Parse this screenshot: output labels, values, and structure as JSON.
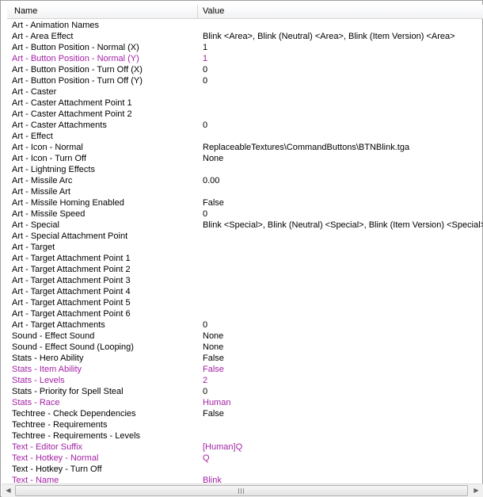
{
  "header": {
    "name": "Name",
    "value": "Value"
  },
  "rows": [
    {
      "name": "Art - Animation Names",
      "value": "",
      "mod": false
    },
    {
      "name": "Art - Area Effect",
      "value": "Blink <Area>, Blink (Neutral) <Area>, Blink (Item Version) <Area>",
      "mod": false
    },
    {
      "name": "Art - Button Position - Normal (X)",
      "value": "1",
      "mod": false
    },
    {
      "name": "Art - Button Position - Normal (Y)",
      "value": "1",
      "mod": true
    },
    {
      "name": "Art - Button Position - Turn Off (X)",
      "value": "0",
      "mod": false
    },
    {
      "name": "Art - Button Position - Turn Off (Y)",
      "value": "0",
      "mod": false
    },
    {
      "name": "Art - Caster",
      "value": "",
      "mod": false
    },
    {
      "name": "Art - Caster Attachment Point 1",
      "value": "",
      "mod": false
    },
    {
      "name": "Art - Caster Attachment Point 2",
      "value": "",
      "mod": false
    },
    {
      "name": "Art - Caster Attachments",
      "value": "0",
      "mod": false
    },
    {
      "name": "Art - Effect",
      "value": "",
      "mod": false
    },
    {
      "name": "Art - Icon - Normal",
      "value": "ReplaceableTextures\\CommandButtons\\BTNBlink.tga",
      "mod": false
    },
    {
      "name": "Art - Icon - Turn Off",
      "value": "None",
      "mod": false
    },
    {
      "name": "Art - Lightning Effects",
      "value": "",
      "mod": false
    },
    {
      "name": "Art - Missile Arc",
      "value": "0.00",
      "mod": false
    },
    {
      "name": "Art - Missile Art",
      "value": "",
      "mod": false
    },
    {
      "name": "Art - Missile Homing Enabled",
      "value": "False",
      "mod": false
    },
    {
      "name": "Art - Missile Speed",
      "value": "0",
      "mod": false
    },
    {
      "name": "Art - Special",
      "value": "Blink <Special>, Blink (Neutral) <Special>, Blink (Item Version) <Special>",
      "mod": false
    },
    {
      "name": "Art - Special Attachment Point",
      "value": "",
      "mod": false
    },
    {
      "name": "Art - Target",
      "value": "",
      "mod": false
    },
    {
      "name": "Art - Target Attachment Point 1",
      "value": "",
      "mod": false
    },
    {
      "name": "Art - Target Attachment Point 2",
      "value": "",
      "mod": false
    },
    {
      "name": "Art - Target Attachment Point 3",
      "value": "",
      "mod": false
    },
    {
      "name": "Art - Target Attachment Point 4",
      "value": "",
      "mod": false
    },
    {
      "name": "Art - Target Attachment Point 5",
      "value": "",
      "mod": false
    },
    {
      "name": "Art - Target Attachment Point 6",
      "value": "",
      "mod": false
    },
    {
      "name": "Art - Target Attachments",
      "value": "0",
      "mod": false
    },
    {
      "name": "Sound - Effect Sound",
      "value": "None",
      "mod": false
    },
    {
      "name": "Sound - Effect Sound (Looping)",
      "value": "None",
      "mod": false
    },
    {
      "name": "Stats - Hero Ability",
      "value": "False",
      "mod": false
    },
    {
      "name": "Stats - Item Ability",
      "value": "False",
      "mod": true
    },
    {
      "name": "Stats - Levels",
      "value": "2",
      "mod": true
    },
    {
      "name": "Stats - Priority for Spell Steal",
      "value": "0",
      "mod": false
    },
    {
      "name": "Stats - Race",
      "value": "Human",
      "mod": true
    },
    {
      "name": "Techtree - Check Dependencies",
      "value": "False",
      "mod": false
    },
    {
      "name": "Techtree - Requirements",
      "value": "",
      "mod": false
    },
    {
      "name": "Techtree - Requirements - Levels",
      "value": "",
      "mod": false
    },
    {
      "name": "Text - Editor Suffix",
      "value": "[Human]Q",
      "mod": true
    },
    {
      "name": "Text - Hotkey - Normal",
      "value": "Q",
      "mod": true
    },
    {
      "name": "Text - Hotkey - Turn Off",
      "value": "",
      "mod": false
    },
    {
      "name": "Text - Name",
      "value": "Blink",
      "mod": true
    }
  ],
  "colors": {
    "modified": "#a321a5",
    "default": "#000000"
  },
  "scrollbar": {
    "left_icon": "scroll-left-arrow-icon",
    "right_icon": "scroll-right-arrow-icon",
    "grip_icon": "grip-icon"
  }
}
